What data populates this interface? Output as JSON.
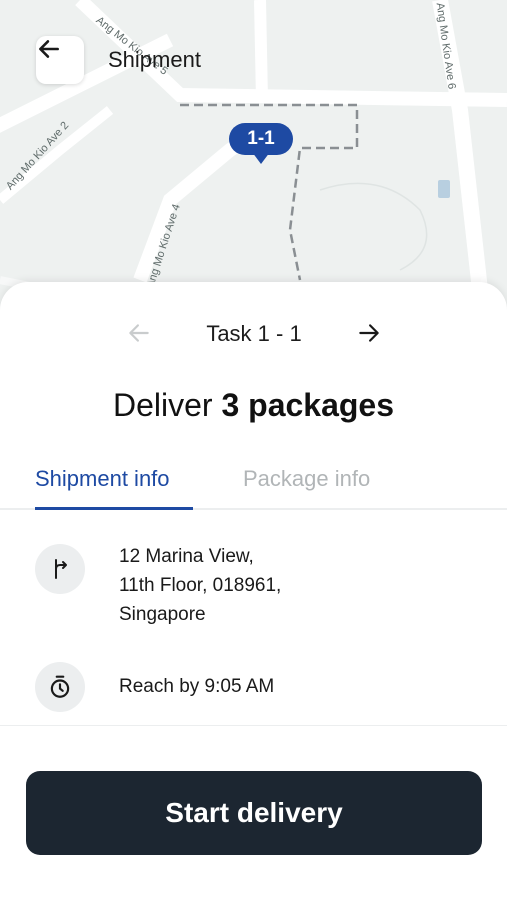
{
  "header": {
    "title": "Shipment"
  },
  "map": {
    "pin_label": "1-1",
    "street_labels": [
      "Ang Mo Kio Ave 5",
      "Ang Mo Kio Ave 2",
      "Ang Mo Kio Ave 4",
      "Ang Mo Kio Ave 6"
    ],
    "colors": {
      "land": "#eef1f0",
      "road": "#ffffff",
      "route": "#8a8f93",
      "pin": "#1e4aa3"
    }
  },
  "task_nav": {
    "label": "Task 1 - 1"
  },
  "headline": {
    "prefix": "Deliver ",
    "emphasis": "3 packages"
  },
  "tabs": [
    {
      "label": "Shipment info",
      "active": true
    },
    {
      "label": "Package info",
      "active": false
    }
  ],
  "shipment_info": {
    "address_lines": [
      "12 Marina View,",
      "11th Floor, 018961,",
      "Singapore"
    ],
    "reach_by": "Reach by 9:05 AM"
  },
  "cta": {
    "label": "Start delivery"
  },
  "colors": {
    "accent": "#1e4aa3",
    "button_bg": "#1c2631",
    "inactive_tab": "#b1b5b7"
  }
}
